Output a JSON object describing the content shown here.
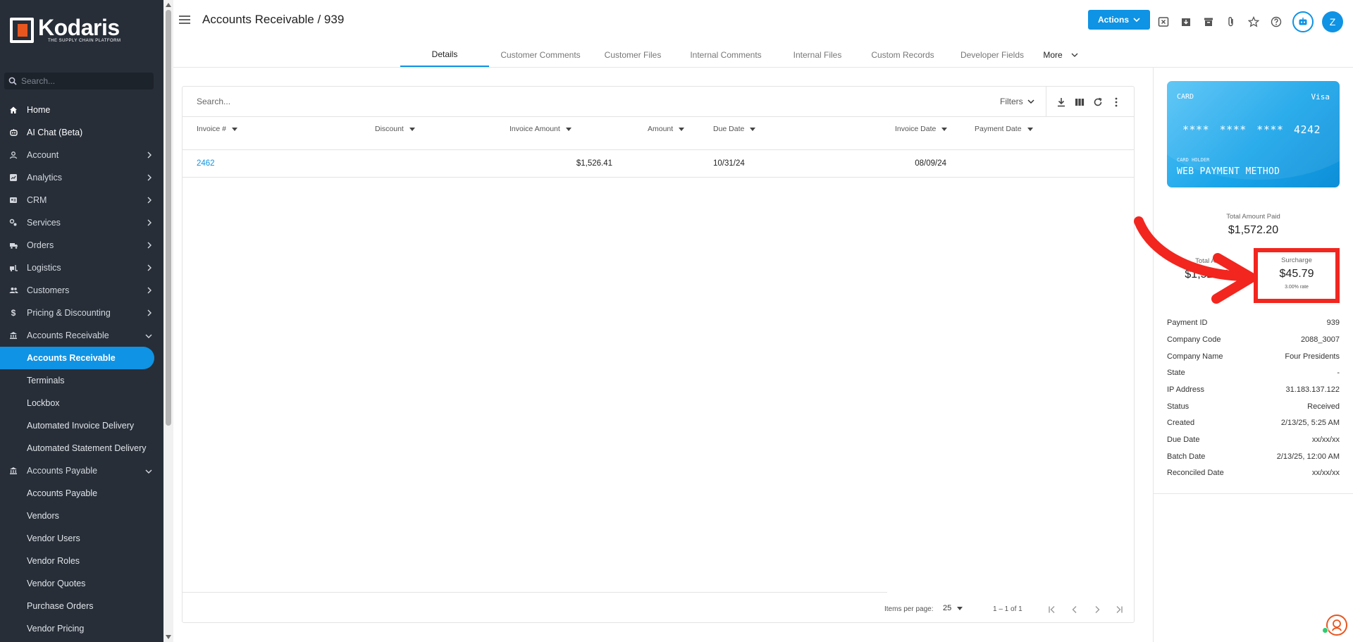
{
  "app": {
    "logo_name": "Kodaris",
    "logo_tagline": "THE SUPPLY CHAIN PLATFORM"
  },
  "sidebar": {
    "search_placeholder": "Search...",
    "items": [
      {
        "label": "Home",
        "icon": "home-icon"
      },
      {
        "label": "AI Chat (Beta)",
        "icon": "robot-icon"
      },
      {
        "label": "Account",
        "icon": "person-icon"
      },
      {
        "label": "Analytics",
        "icon": "analytics-icon"
      },
      {
        "label": "CRM",
        "icon": "contact-card-icon"
      },
      {
        "label": "Services",
        "icon": "services-icon"
      },
      {
        "label": "Orders",
        "icon": "truck-icon"
      },
      {
        "label": "Logistics",
        "icon": "forklift-icon"
      },
      {
        "label": "Customers",
        "icon": "group-icon"
      },
      {
        "label": "Pricing & Discounting",
        "icon": "dollar-icon"
      },
      {
        "label": "Accounts Receivable",
        "icon": "bank-icon"
      },
      {
        "label": "Accounts Receivable"
      },
      {
        "label": "Terminals"
      },
      {
        "label": "Lockbox"
      },
      {
        "label": "Automated Invoice Delivery"
      },
      {
        "label": "Automated Statement Delivery"
      },
      {
        "label": "Accounts Payable",
        "icon": "bank-icon"
      },
      {
        "label": "Accounts Payable"
      },
      {
        "label": "Vendors"
      },
      {
        "label": "Vendor Users"
      },
      {
        "label": "Vendor Roles"
      },
      {
        "label": "Vendor Quotes"
      },
      {
        "label": "Purchase Orders"
      },
      {
        "label": "Vendor Pricing"
      }
    ]
  },
  "header": {
    "title": "Accounts Receivable / 939",
    "actions_label": "Actions",
    "avatar_initial": "Z"
  },
  "tabs": [
    "Details",
    "Customer Comments",
    "Customer Files",
    "Internal Comments",
    "Internal Files",
    "Custom Records",
    "Developer Fields",
    "More"
  ],
  "table": {
    "search_placeholder": "Search...",
    "filters_label": "Filters",
    "columns": [
      "Invoice #",
      "Discount",
      "Invoice Amount",
      "Amount",
      "Due Date",
      "Invoice Date",
      "Payment Date"
    ],
    "rows": [
      {
        "invoice": "2462",
        "discount": "",
        "invoice_amount": "$1,526.41",
        "amount": "",
        "due_date": "10/31/24",
        "invoice_date": "08/09/24",
        "payment_date": ""
      }
    ],
    "pager": {
      "items_per_page_label": "Items per page:",
      "items_per_page": "25",
      "range": "1 – 1 of 1"
    }
  },
  "payment_card": {
    "type_label": "CARD",
    "brand": "Visa",
    "number": "**** **** **** 4242",
    "holder_label": "CARD HOLDER",
    "holder": "WEB PAYMENT METHOD"
  },
  "totals": {
    "paid_label": "Total Amount Paid",
    "paid_value": "$1,572.20",
    "amount_label": "Total Amo",
    "amount_value": "$1,526.41",
    "surcharge_label": "Surcharge",
    "surcharge_value": "$45.79",
    "surcharge_rate": "3.00% rate"
  },
  "details": [
    {
      "label": "Payment ID",
      "value": "939"
    },
    {
      "label": "Company Code",
      "value": "2088_3007"
    },
    {
      "label": "Company Name",
      "value": "Four Presidents"
    },
    {
      "label": "State",
      "value": "-"
    },
    {
      "label": "IP Address",
      "value": "31.183.137.122"
    },
    {
      "label": "Status",
      "value": "Received"
    },
    {
      "label": "Created",
      "value": "2/13/25, 5:25 AM"
    },
    {
      "label": "Due Date",
      "value": "xx/xx/xx"
    },
    {
      "label": "Batch Date",
      "value": "2/13/25, 12:00 AM"
    },
    {
      "label": "Reconciled Date",
      "value": "xx/xx/xx"
    }
  ],
  "colors": {
    "accent": "#0f93e4",
    "sidebar_bg": "#272e38",
    "highlight": "#f2261f",
    "brand_orange": "#e8561f"
  }
}
